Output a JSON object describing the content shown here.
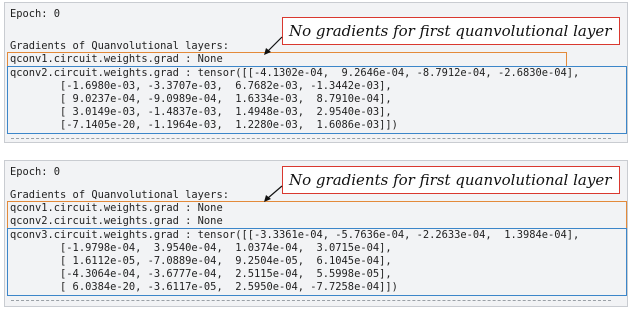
{
  "panel1": {
    "epoch": "Epoch: 0",
    "header": "Gradients of Quanvolutional layers:",
    "grad_none": [
      "qconv1.circuit.weights.grad : None"
    ],
    "tensor_lines": [
      "qconv2.circuit.weights.grad : tensor([[-4.1302e-04,  9.2646e-04, -8.7912e-04, -2.6830e-04],",
      "        [-1.6980e-03, -3.3707e-03,  6.7682e-03, -1.3442e-03],",
      "        [ 9.0237e-04, -9.0989e-04,  1.6334e-03,  8.7910e-04],",
      "        [ 3.0149e-03, -1.4837e-03,  1.4948e-03,  2.9540e-03],",
      "        [-7.1405e-20, -1.1964e-03,  1.2280e-03,  1.6086e-03]])"
    ],
    "callout": "No gradients for first quanvolutional layer"
  },
  "panel2": {
    "epoch": "Epoch: 0",
    "header": "Gradients of Quanvolutional layers:",
    "grad_none": [
      "qconv1.circuit.weights.grad : None",
      "qconv2.circuit.weights.grad : None"
    ],
    "tensor_lines": [
      "qconv3.circuit.weights.grad : tensor([[-3.3361e-04, -5.7636e-04, -2.2633e-04,  1.3984e-04],",
      "        [-1.9798e-04,  3.9540e-04,  1.0374e-04,  3.0715e-04],",
      "        [ 1.6112e-05, -7.0889e-04,  9.2504e-05,  6.1045e-04],",
      "        [-4.3064e-04, -3.6777e-04,  2.5115e-04,  5.5998e-05],",
      "        [ 6.0384e-20, -3.6117e-05,  2.5950e-04, -7.7258e-04]])"
    ],
    "callout": "No gradients for first quanvolutional layer"
  },
  "colors": {
    "none_box": "#e38a3a",
    "tensor_box": "#3c86c9",
    "callout_border": "#d9382f",
    "panel_bg": "#f2f3f5"
  }
}
